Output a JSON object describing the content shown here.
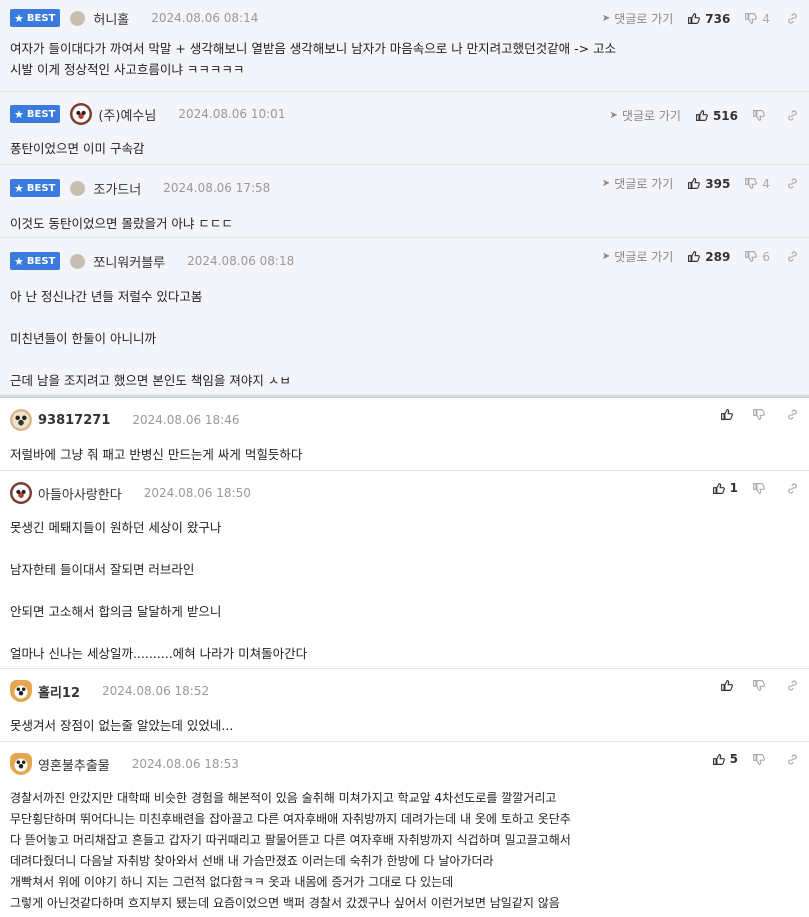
{
  "ui": {
    "best_label": "BEST",
    "reply_label": "댓글로 가기"
  },
  "comments": [
    {
      "best": true,
      "nick": "허니홀",
      "date": "2024.08.06 08:14",
      "up": "736",
      "down": "4",
      "body": [
        "여자가 들이대다가 까여서 막말 + 생각해보니 열받음 생각해보니 남자가 마음속으로 나 만지려고했던것같애 -> 고소",
        "시발 이게 정상적인 사고흐름이냐 ㅋㅋㅋㅋㅋ"
      ]
    },
    {
      "best": true,
      "nick": "(주)예수님",
      "date": "2024.08.06 10:01",
      "up": "516",
      "down": "",
      "body": [
        "퐁탄이었으면 이미 구속감"
      ]
    },
    {
      "best": true,
      "nick": "조가드너",
      "date": "2024.08.06 17:58",
      "up": "395",
      "down": "4",
      "body": [
        "이것도 동탄이었으면 몰랐을거 아냐 ㄷㄷㄷ"
      ]
    },
    {
      "best": true,
      "nick": "쪼니워커블루",
      "date": "2024.08.06 08:18",
      "up": "289",
      "down": "6",
      "body": [
        "아 난 정신나간 년들 저럴수 있다고봄",
        "미친년들이 한둘이 아니니까",
        "근데 남을 조지려고 했으면 본인도 책임을 져야지 ㅅㅂ"
      ]
    },
    {
      "best": false,
      "nick": "93817271",
      "date": "2024.08.06 18:46",
      "up": "",
      "down": "",
      "body": [
        "저럴바에 그냥 줘 패고 반병신 만드는게 싸게 먹힐듯하다"
      ]
    },
    {
      "best": false,
      "nick": "아들아사랑한다",
      "date": "2024.08.06 18:50",
      "up": "1",
      "down": "",
      "body": [
        "못생긴 메퇘지들이 원하던 세상이 왔구나",
        "남자한테 들이대서 잘되면 러브라인",
        "안되면 고소해서 합의금 달달하게 받으니",
        "얼마나 신나는 세상일까..........에혀 나라가 미쳐돌아간다"
      ]
    },
    {
      "best": false,
      "nick": "홀리12",
      "date": "2024.08.06 18:52",
      "up": "",
      "down": "",
      "body": [
        "못생겨서 장점이 없는줄 알았는데 있었네..."
      ]
    },
    {
      "best": false,
      "nick": "영혼불추출물",
      "date": "2024.08.06 18:53",
      "up": "5",
      "down": "",
      "body": [
        "경찰서까진 안갔지만 대학때 비슷한 경험을 해본적이 있음 술취해 미쳐가지고 학교앞 4차선도로를 깔깔거리고\n무단횡단하며 뛰어다니는 미친후배련을 잡아끌고 다른 여자후배애 자취방까지 데려가는데 내 옷에 토하고 옷단추\n다 뜯어놓고 머리채잡고 흔들고 갑자기 따귀때리고 팔물어뜯고 다른 여자후배 자취방까지 식겁하며 밀고끌고해서\n데려다줬더니 다음날 자취방 찾아와서 선배 내 가슴만졌죠 이러는데 숙취가 한방에 다 날아가더라\n개빡쳐서 위에 이야기 하니 지는 그런적 없다함ㅋㅋ 옷과 내몸에 증거가 그대로 다 있는데\n그렇게 아닌것같다하며 흐지부지 됐는데 요즘이었으면 백퍼 경찰서 갔겠구나 싶어서 이런거보면 남일같지 않음"
      ]
    }
  ]
}
